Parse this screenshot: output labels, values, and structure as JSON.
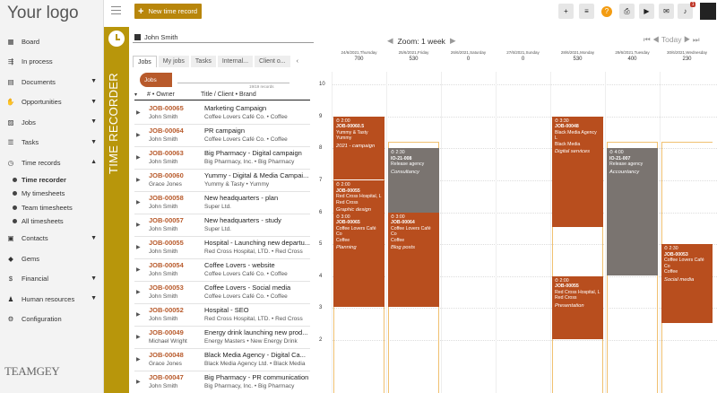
{
  "logo_text": "Your logo",
  "brand_text": "TEAMGEY",
  "topbar": {
    "new_record_label": "New time record"
  },
  "sidebar": {
    "items": [
      {
        "label": "Board",
        "icon": "grid-icon",
        "chevron": false
      },
      {
        "label": "In process",
        "icon": "process-icon",
        "chevron": false
      },
      {
        "label": "Documents",
        "icon": "document-icon",
        "chevron": true
      },
      {
        "label": "Opportunities",
        "icon": "handshake-icon",
        "chevron": true
      },
      {
        "label": "Jobs",
        "icon": "jobs-icon",
        "chevron": true
      },
      {
        "label": "Tasks",
        "icon": "tasks-icon",
        "chevron": true
      },
      {
        "label": "Time records",
        "icon": "clock-icon",
        "chevron": true
      }
    ],
    "subitems": [
      {
        "label": "Time recorder",
        "active": true
      },
      {
        "label": "My timesheets",
        "active": false
      },
      {
        "label": "Team timesheets",
        "active": false
      },
      {
        "label": "All timesheets",
        "active": false
      }
    ],
    "items2": [
      {
        "label": "Contacts",
        "icon": "contacts-icon",
        "chevron": true
      },
      {
        "label": "Gems",
        "icon": "gem-icon",
        "chevron": false
      },
      {
        "label": "Financial",
        "icon": "dollar-icon",
        "chevron": true
      },
      {
        "label": "Human resources",
        "icon": "people-icon",
        "chevron": true
      },
      {
        "label": "Configuration",
        "icon": "gear-icon",
        "chevron": false
      }
    ]
  },
  "panel_title": "TIME RECORDER",
  "user_select": "John Smith",
  "tabs": [
    "Jobs",
    "My jobs",
    "Tasks",
    "Internal...",
    "Client o..."
  ],
  "chip_label": "Jobs",
  "records_count": "19/19 records",
  "table_headers": {
    "owner": "# • Owner",
    "title": "Title / Client • Brand"
  },
  "jobs": [
    {
      "id": "JOB-00065",
      "owner": "John Smith",
      "title": "Marketing Campaign",
      "client": "Coffee Lovers Café Co. • Coffee"
    },
    {
      "id": "JOB-00064",
      "owner": "John Smith",
      "title": "PR campaign",
      "client": "Coffee Lovers Café Co. • Coffee"
    },
    {
      "id": "JOB-00063",
      "owner": "John Smith",
      "title": "Big Pharmacy - Digital campaign",
      "client": "Big Pharmacy, Inc. • Big Pharmacy"
    },
    {
      "id": "JOB-00060",
      "owner": "Grace Jones",
      "title": "Yummy - Digital & Media Campai...",
      "client": "Yummy & Tasty • Yummy"
    },
    {
      "id": "JOB-00058",
      "owner": "John Smith",
      "title": "New headquarters - plan",
      "client": "Super Ltd."
    },
    {
      "id": "JOB-00057",
      "owner": "John Smith",
      "title": "New headquarters - study",
      "client": "Super Ltd."
    },
    {
      "id": "JOB-00055",
      "owner": "John Smith",
      "title": "Hospital - Launching new departu...",
      "client": "Red Cross Hospital, LTD. • Red Cross"
    },
    {
      "id": "JOB-00054",
      "owner": "John Smith",
      "title": "Coffee Lovers - website",
      "client": "Coffee Lovers Café Co. • Coffee"
    },
    {
      "id": "JOB-00053",
      "owner": "John Smith",
      "title": "Coffee Lovers - Social media",
      "client": "Coffee Lovers Café Co. • Coffee"
    },
    {
      "id": "JOB-00052",
      "owner": "John Smith",
      "title": "Hospital - SEO",
      "client": "Red Cross Hospital, LTD. • Red Cross"
    },
    {
      "id": "JOB-00049",
      "owner": "Michael Wright",
      "title": "Energy drink launching new prod...",
      "client": "Energy Masters • New Energy Drink"
    },
    {
      "id": "JOB-00048",
      "owner": "Grace Jones",
      "title": "Black Media Agency - Digital Ca...",
      "client": "Black Media Agency Ltd. • Black Media"
    },
    {
      "id": "JOB-00047",
      "owner": "John Smith",
      "title": "Big Pharmacy - PR communication",
      "client": "Big Pharmacy, Inc. • Big Pharmacy"
    }
  ],
  "calendar": {
    "zoom_label": "Zoom: 1 week",
    "today_label": "Today",
    "days": [
      {
        "date": "24/6/2021,Thursday",
        "total": "700"
      },
      {
        "date": "25/6/2021,Friday",
        "total": "530"
      },
      {
        "date": "26/6/2021,Saturday",
        "total": "0"
      },
      {
        "date": "27/6/2021,Sunday",
        "total": "0"
      },
      {
        "date": "28/6/2021,Monday",
        "total": "530"
      },
      {
        "date": "29/6/2021,Tuesday",
        "total": "400"
      },
      {
        "date": "30/6/2021,Wednesday",
        "total": "230"
      }
    ],
    "hours": [
      "10",
      "9",
      "8",
      "7",
      "6",
      "5",
      "4",
      "3",
      "2"
    ],
    "entries": [
      {
        "day": 0,
        "start": 7.0,
        "dur": 2.0,
        "color": "#b84e1e",
        "time": "2:00",
        "job": "JOB-00060.5",
        "client": "Yummy & Tasty",
        "brand": "Yummy",
        "note": "2021 - campaign"
      },
      {
        "day": 0,
        "start": 5.0,
        "dur": 2.0,
        "color": "#b84e1e",
        "time": "2:00",
        "job": "JOB-00055",
        "client": "Red Cross Hospital, L",
        "brand": "Red Cross",
        "note": "Graphic design"
      },
      {
        "day": 0,
        "start": 3.0,
        "dur": 3.0,
        "color": "#b84e1e",
        "time": "3:00",
        "job": "JOB-00065",
        "client": "Coffee Lovers Café Co",
        "brand": "Coffee",
        "note": "Planning"
      },
      {
        "day": 1,
        "start": 5.5,
        "dur": 2.5,
        "color": "#7a7470",
        "time": "2:30",
        "job": "IO-21-008",
        "client": "Release agency",
        "brand": "",
        "note": "Consultancy"
      },
      {
        "day": 1,
        "start": 3.0,
        "dur": 3.0,
        "color": "#b84e1e",
        "time": "3:00",
        "job": "JOB-00064",
        "client": "Coffee Lovers Café Co",
        "brand": "Coffee",
        "note": "Blog posts"
      },
      {
        "day": 4,
        "start": 5.5,
        "dur": 3.5,
        "color": "#b84e1e",
        "time": "3:30",
        "job": "JOB-00048",
        "client": "Black Media Agency L",
        "brand": "Black Media",
        "note": "Digital services"
      },
      {
        "day": 4,
        "start": 2.0,
        "dur": 2.0,
        "color": "#b84e1e",
        "time": "2:00",
        "job": "JOB-00055",
        "client": "Red Cross Hospital, L",
        "brand": "Red Cross",
        "note": "Presentation"
      },
      {
        "day": 5,
        "start": 4.0,
        "dur": 4.0,
        "color": "#7a7470",
        "time": "4:00",
        "job": "IO-21-007",
        "client": "Release agency",
        "brand": "",
        "note": "Accountancy"
      },
      {
        "day": 6,
        "start": 2.5,
        "dur": 2.5,
        "color": "#b84e1e",
        "time": "2:30",
        "job": "JOB-00053",
        "client": "Coffee Lovers Café Co",
        "brand": "Coffee",
        "note": "Social media"
      }
    ]
  }
}
